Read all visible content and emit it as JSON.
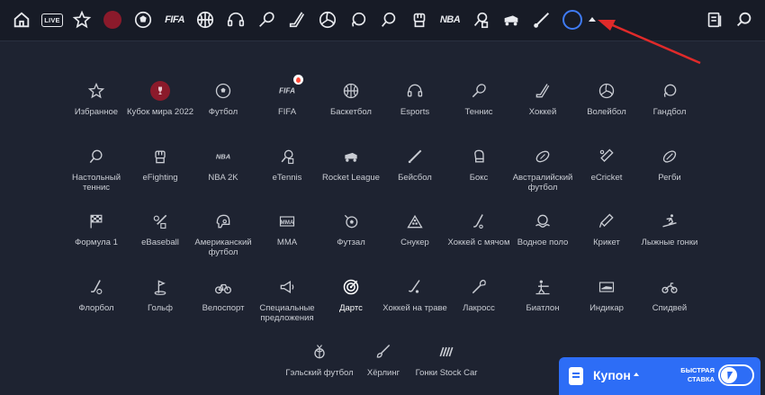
{
  "topbar": {
    "live_label": "LIVE",
    "fifa_label": "FIFA",
    "nba_label": "NBA"
  },
  "sports": [
    {
      "label": "Избранное",
      "icon": "star-icon"
    },
    {
      "label": "Кубок мира 2022",
      "icon": "world-cup-icon"
    },
    {
      "label": "Футбол",
      "icon": "soccer-ball-icon"
    },
    {
      "label": "FIFA",
      "icon": "fifa-icon"
    },
    {
      "label": "Баскетбол",
      "icon": "basketball-icon"
    },
    {
      "label": "Esports",
      "icon": "headset-icon"
    },
    {
      "label": "Теннис",
      "icon": "tennis-racket-icon"
    },
    {
      "label": "Хоккей",
      "icon": "hockey-stick-icon"
    },
    {
      "label": "Волейбол",
      "icon": "volleyball-icon"
    },
    {
      "label": "Гандбол",
      "icon": "handball-icon"
    },
    {
      "label": "Настольный теннис",
      "icon": "table-tennis-icon"
    },
    {
      "label": "eFighting",
      "icon": "fist-icon"
    },
    {
      "label": "NBA 2K",
      "icon": "nba2k-icon"
    },
    {
      "label": "eTennis",
      "icon": "etennis-icon"
    },
    {
      "label": "Rocket League",
      "icon": "rocket-car-icon"
    },
    {
      "label": "Бейсбол",
      "icon": "baseball-bat-icon"
    },
    {
      "label": "Бокс",
      "icon": "boxing-glove-icon"
    },
    {
      "label": "Австралийский футбол",
      "icon": "aussie-ball-icon"
    },
    {
      "label": "eCricket",
      "icon": "ecricket-icon"
    },
    {
      "label": "Регби",
      "icon": "rugby-ball-icon"
    },
    {
      "label": "Формула 1",
      "icon": "checkered-flag-icon"
    },
    {
      "label": "eBaseball",
      "icon": "ebaseball-icon"
    },
    {
      "label": "Американский футбол",
      "icon": "football-helmet-icon"
    },
    {
      "label": "MMA",
      "icon": "mma-icon"
    },
    {
      "label": "Футзал",
      "icon": "futsal-icon"
    },
    {
      "label": "Снукер",
      "icon": "snooker-icon"
    },
    {
      "label": "Хоккей с мячом",
      "icon": "bandy-icon"
    },
    {
      "label": "Водное поло",
      "icon": "water-polo-icon"
    },
    {
      "label": "Крикет",
      "icon": "cricket-bat-icon"
    },
    {
      "label": "Лыжные гонки",
      "icon": "skier-icon"
    },
    {
      "label": "Флорбол",
      "icon": "floorball-icon"
    },
    {
      "label": "Гольф",
      "icon": "golf-flag-icon"
    },
    {
      "label": "Велоспорт",
      "icon": "bicycle-icon"
    },
    {
      "label": "Специальные предложения",
      "icon": "megaphone-icon"
    },
    {
      "label": "Дартс",
      "icon": "darts-target-icon"
    },
    {
      "label": "Хоккей на траве",
      "icon": "field-hockey-icon"
    },
    {
      "label": "Лакросс",
      "icon": "lacrosse-icon"
    },
    {
      "label": "Биатлон",
      "icon": "biathlon-icon"
    },
    {
      "label": "Индикар",
      "icon": "indycar-icon"
    },
    {
      "label": "Спидвей",
      "icon": "motorbike-icon"
    },
    {
      "label": "Гэльский футбол",
      "icon": "gaelic-ball-icon"
    },
    {
      "label": "Хёрлинг",
      "icon": "hurling-icon"
    },
    {
      "label": "Гонки Stock Car",
      "icon": "stock-car-icon"
    }
  ],
  "coupon": {
    "label": "Купон",
    "fast_bet_label": "БЫСТРАЯ СТАВКА"
  },
  "annotation_color": "#e02a2a",
  "accent_color": "#2d6df6"
}
